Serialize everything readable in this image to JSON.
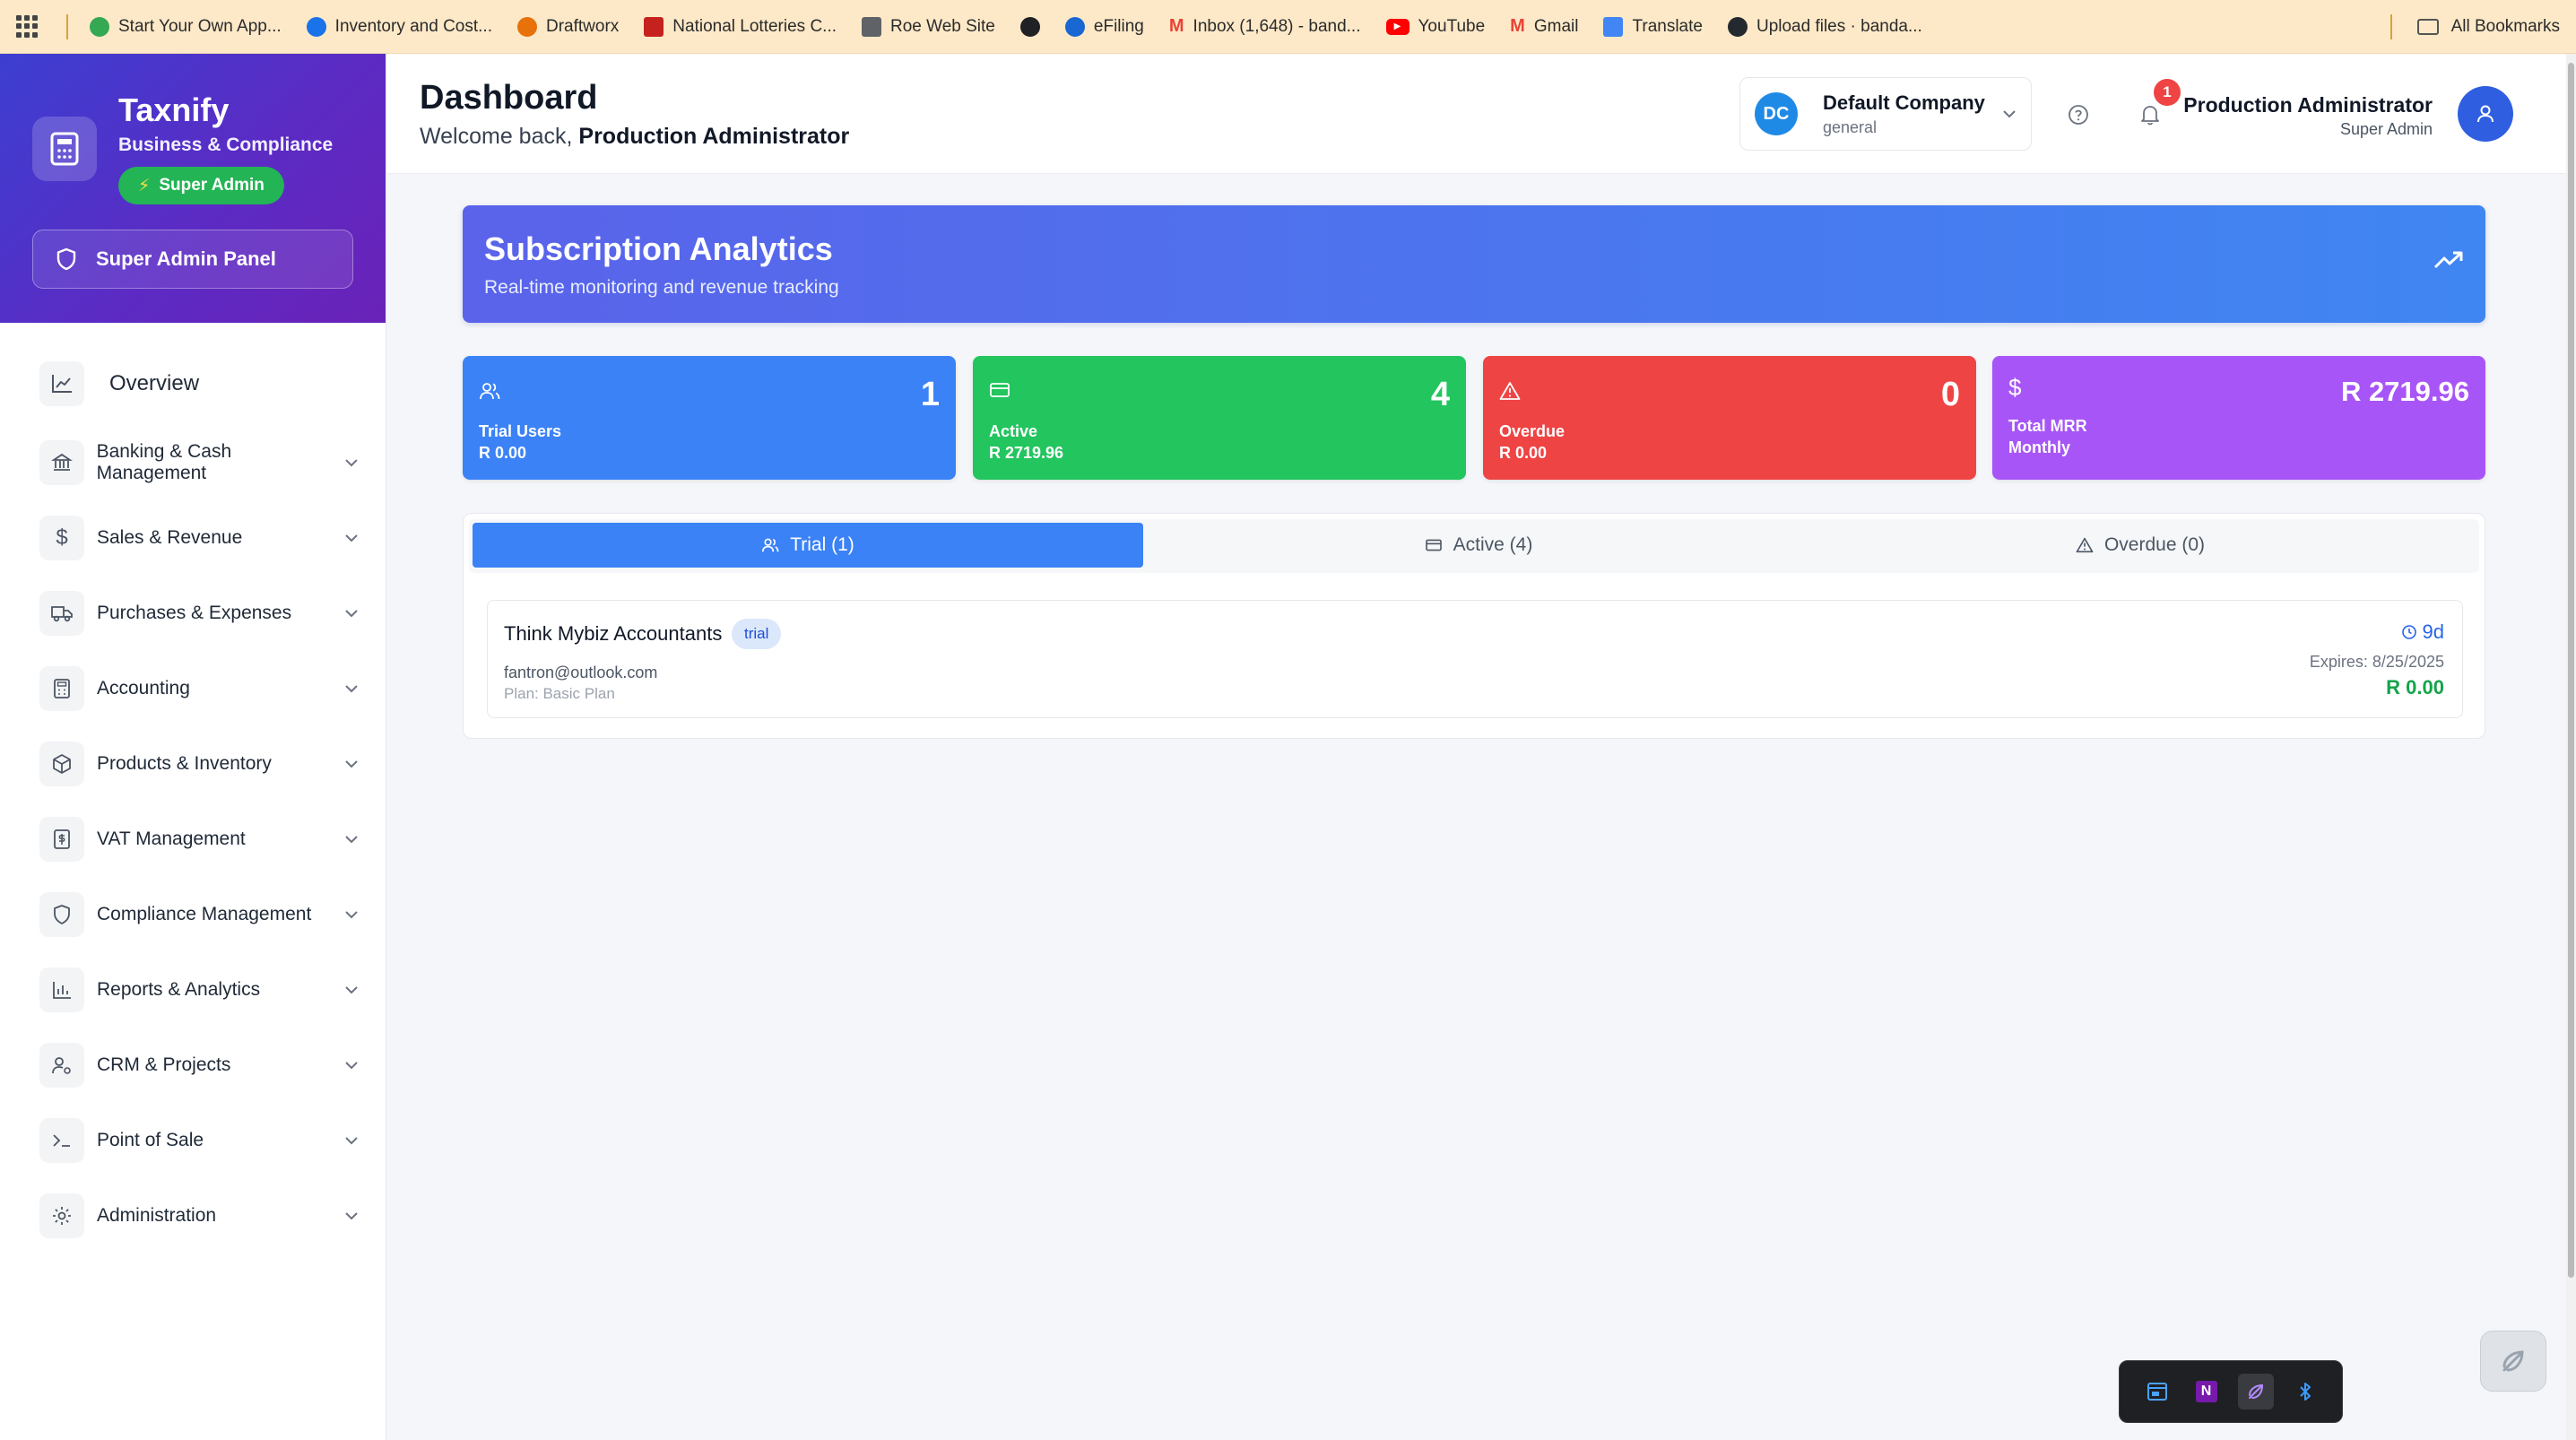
{
  "bookmarks": {
    "items": [
      {
        "label": "Start Your Own App...",
        "color": "#34a853"
      },
      {
        "label": "Inventory and Cost...",
        "color": "#1a73e8"
      },
      {
        "label": "Draftworx",
        "color": "#e8710a"
      },
      {
        "label": "National Lotteries C...",
        "color": "#c5221f"
      },
      {
        "label": "Roe Web Site",
        "color": "#5f6368"
      },
      {
        "label": "",
        "color": "#202124"
      },
      {
        "label": "eFiling",
        "color": "#1967d2"
      },
      {
        "label": "Inbox (1,648) - band...",
        "color": "#ea4335"
      },
      {
        "label": "YouTube",
        "color": "#ff0000"
      },
      {
        "label": "Gmail",
        "color": "#ea4335"
      },
      {
        "label": "Translate",
        "color": "#4285f4"
      },
      {
        "label": "Upload files · banda...",
        "color": "#24292f"
      }
    ],
    "all_bookmarks": "All Bookmarks"
  },
  "brand": {
    "name": "Taxnify",
    "subtitle": "Business & Compliance",
    "badge": "Super Admin",
    "panel_button": "Super Admin Panel"
  },
  "nav": {
    "overview": "Overview",
    "items": [
      {
        "label": "Banking & Cash Management",
        "icon": "bank-icon"
      },
      {
        "label": "Sales & Revenue",
        "icon": "dollar-icon"
      },
      {
        "label": "Purchases & Expenses",
        "icon": "truck-icon"
      },
      {
        "label": "Accounting",
        "icon": "calculator-icon"
      },
      {
        "label": "Products & Inventory",
        "icon": "box-icon"
      },
      {
        "label": "VAT Management",
        "icon": "receipt-icon"
      },
      {
        "label": "Compliance Management",
        "icon": "shield-icon"
      },
      {
        "label": "Reports & Analytics",
        "icon": "bar-chart-icon"
      },
      {
        "label": "CRM & Projects",
        "icon": "user-settings-icon"
      },
      {
        "label": "Point of Sale",
        "icon": "terminal-icon"
      },
      {
        "label": "Administration",
        "icon": "gear-icon"
      }
    ]
  },
  "header": {
    "title": "Dashboard",
    "welcome_prefix": "Welcome back,",
    "welcome_name": "Production Administrator",
    "company": {
      "initials": "DC",
      "name": "Default Company",
      "sub": "general"
    },
    "notification_count": "1",
    "user": {
      "name": "Production Administrator",
      "role": "Super Admin"
    }
  },
  "hero": {
    "title": "Subscription Analytics",
    "subtitle": "Real-time monitoring and revenue tracking"
  },
  "stats": [
    {
      "value": "1",
      "label": "Trial Users",
      "sub": "R 0.00",
      "color": "#3b82f6"
    },
    {
      "value": "4",
      "label": "Active",
      "sub": "R 2719.96",
      "color": "#22c55e"
    },
    {
      "value": "0",
      "label": "Overdue",
      "sub": "R 0.00",
      "color": "#ef4444"
    },
    {
      "value": "R 2719.96",
      "label": "Total MRR",
      "sub": "Monthly",
      "color": "#a855f7"
    }
  ],
  "tabs": [
    {
      "label": "Trial (1)"
    },
    {
      "label": "Active (4)"
    },
    {
      "label": "Overdue (0)"
    }
  ],
  "subscription": {
    "name": "Think Mybiz Accountants",
    "status": "trial",
    "email": "fantron@outlook.com",
    "plan": "Plan: Basic Plan",
    "days_left": "9d",
    "expires": "Expires: 8/25/2025",
    "amount": "R 0.00"
  }
}
